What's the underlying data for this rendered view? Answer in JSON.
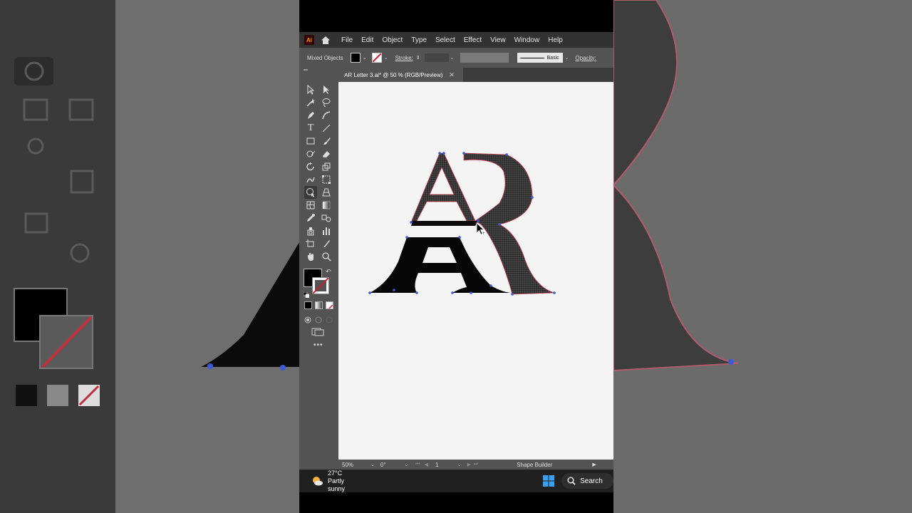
{
  "app": {
    "logo": "Ai",
    "menu": [
      "File",
      "Edit",
      "Object",
      "Type",
      "Select",
      "Effect",
      "View",
      "Window",
      "Help"
    ]
  },
  "control": {
    "selection_label": "Mixed Objects",
    "stroke_label": "Stroke:",
    "brush_label": "Basic",
    "opacity_label": "Opacity:"
  },
  "document": {
    "tab_title": "AR Letter 3.ai* @ 50 % (RGB/Preview)"
  },
  "status": {
    "zoom": "50%",
    "rotation": "0°",
    "artboard_number": "1",
    "tool_name": "Shape Builder"
  },
  "taskbar": {
    "temperature": "27°C",
    "weather": "Partly sunny",
    "search": "Search"
  },
  "colors": {
    "menubar": "#323232",
    "panel": "#535353",
    "artboard": "#f4f4f4",
    "selection_pink": "#d0405a",
    "anchor_blue": "#3a5ad6"
  }
}
